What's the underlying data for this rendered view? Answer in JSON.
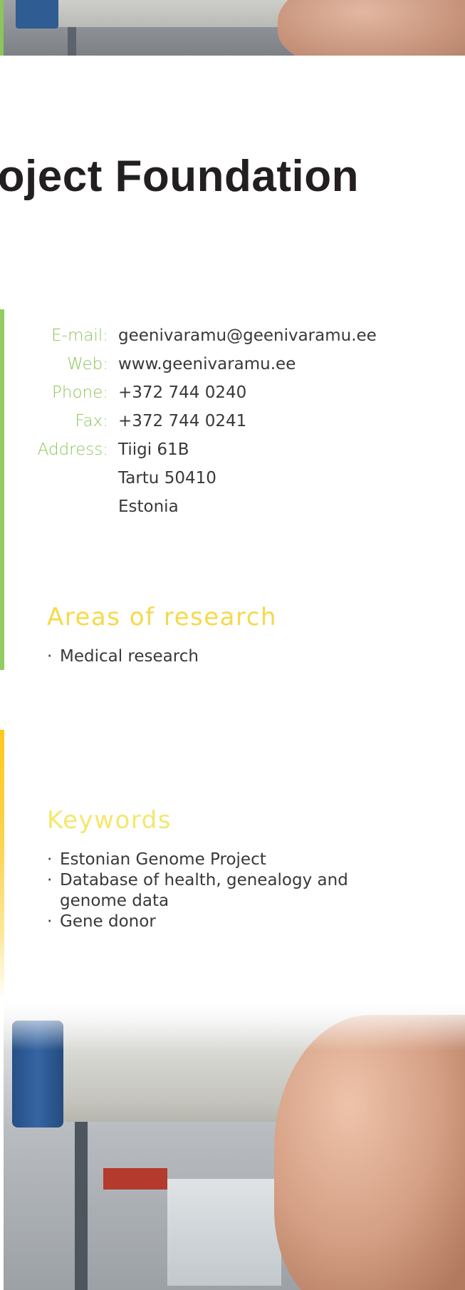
{
  "title": "roject Foundation",
  "contacts": [
    {
      "label": "E-mail:",
      "value": "geenivaramu@geenivaramu.ee"
    },
    {
      "label": "Web:",
      "value": "www.geenivaramu.ee"
    },
    {
      "label": "Phone:",
      "value": "+372 744 0240"
    },
    {
      "label": "Fax:",
      "value": "+372 744 0241"
    },
    {
      "label": "Address:",
      "value": "Tiigi 61B"
    },
    {
      "label": "",
      "value": "Tartu 50410"
    },
    {
      "label": "",
      "value": "Estonia"
    }
  ],
  "areas": {
    "heading": "Areas of research",
    "items": [
      "Medical research"
    ]
  },
  "keywords": {
    "heading": "Keywords",
    "items": [
      "Estonian Genome Project",
      "Database of health, genealogy and genome data",
      "Gene donor"
    ]
  },
  "bullet": "·",
  "colors": {
    "label_green": "#8cc55a",
    "accent_green": "#92cc62",
    "heading_yellow": "#f4e84a",
    "accent_yellow": "#ffc81a",
    "text": "#3a3739",
    "title": "#231f20"
  }
}
